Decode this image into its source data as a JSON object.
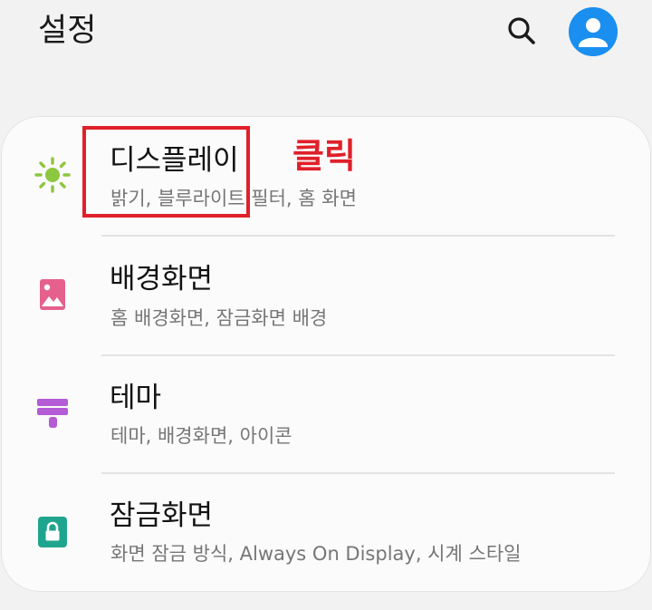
{
  "header": {
    "title": "설정",
    "search_icon": "search-icon",
    "account_icon": "account-circle-icon",
    "account_color": "#1a8ff0"
  },
  "settings": [
    {
      "label": "디스플레이",
      "sub": "밝기, 블루라이트 필터, 홈 화면",
      "icon": "brightness-icon",
      "icon_color": "#8dc63f"
    },
    {
      "label": "배경화면",
      "sub": "홈 배경화면, 잠금화면 배경",
      "icon": "wallpaper-icon",
      "icon_color": "#e5608d"
    },
    {
      "label": "테마",
      "sub": "테마, 배경화면, 아이콘",
      "icon": "theme-brush-icon",
      "icon_color": "#b45bd6"
    },
    {
      "label": "잠금화면",
      "sub": "화면 잠금 방식, Always On Display, 시계 스타일",
      "icon": "lock-icon",
      "icon_color": "#1fa58d"
    }
  ],
  "annotation": {
    "text": "클릭",
    "color": "#e0202a"
  }
}
